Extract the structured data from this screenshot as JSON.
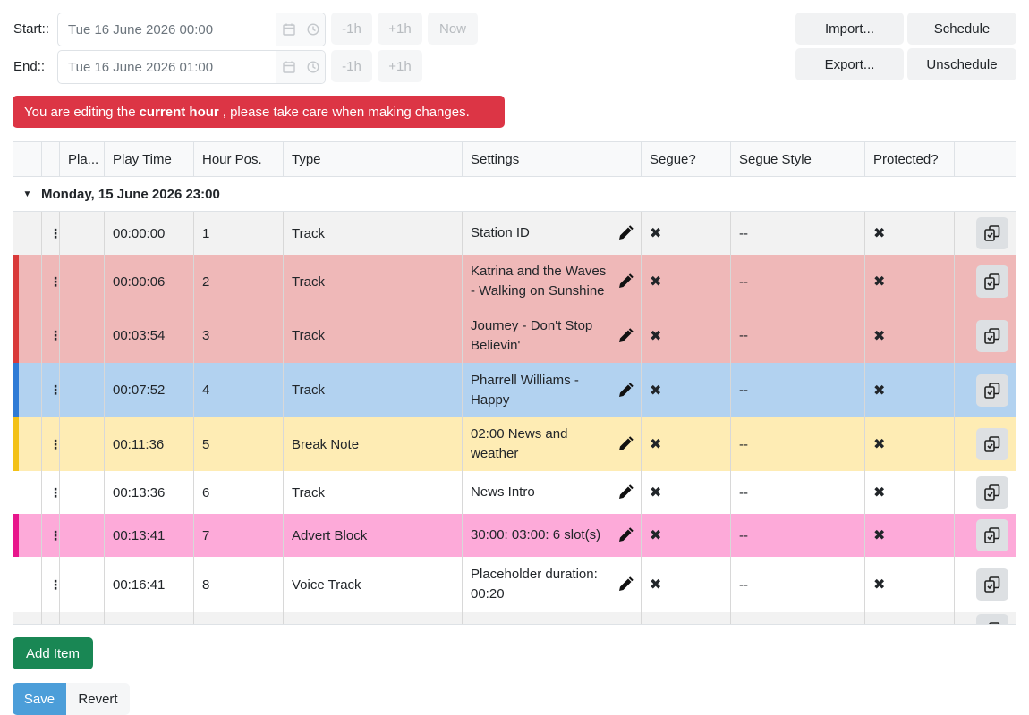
{
  "range": {
    "start_label": "Start::",
    "start_value": "Tue 16 June 2026 00:00",
    "end_label": "End::",
    "end_value": "Tue 16 June 2026 01:00",
    "minus_label": "-1h",
    "plus_label": "+1h",
    "now_label": "Now"
  },
  "actions": {
    "import": "Import...",
    "schedule": "Schedule",
    "export": "Export...",
    "unschedule": "Unschedule"
  },
  "alert": {
    "before": "You are editing the",
    "strong": "current hour",
    "after": ", please take care when making changes."
  },
  "columns": [
    "",
    "",
    "Pla...",
    "Play Time",
    "Hour Pos.",
    "Type",
    "Settings",
    "Segue?",
    "Segue Style",
    "Protected?",
    ""
  ],
  "group_label": "Monday, 15 June 2026 23:00",
  "rows": [
    {
      "time": "00:00:00",
      "pos": "1",
      "type": "Track",
      "settings": "Station ID",
      "segue_style": "--",
      "bg": "#f2f2f2",
      "stripe": ""
    },
    {
      "time": "00:00:06",
      "pos": "2",
      "type": "Track",
      "settings": "Katrina and the Waves - Walking on Sunshine",
      "segue_style": "--",
      "bg": "#efb8b8",
      "stripe": "#d93a3a"
    },
    {
      "time": "00:03:54",
      "pos": "3",
      "type": "Track",
      "settings": "Journey - Don't Stop Believin'",
      "segue_style": "--",
      "bg": "#efb8b8",
      "stripe": "#d93a3a"
    },
    {
      "time": "00:07:52",
      "pos": "4",
      "type": "Track",
      "settings": "Pharrell Williams - Happy",
      "segue_style": "--",
      "bg": "#b2d2f0",
      "stripe": "#2f7bd6"
    },
    {
      "time": "00:11:36",
      "pos": "5",
      "type": "Break Note",
      "settings": "02:00 News and weather",
      "segue_style": "--",
      "bg": "#feecb4",
      "stripe": "#f3c117"
    },
    {
      "time": "00:13:36",
      "pos": "6",
      "type": "Track",
      "settings": "News Intro",
      "segue_style": "--",
      "bg": "#ffffff",
      "stripe": ""
    },
    {
      "time": "00:13:41",
      "pos": "7",
      "type": "Advert Block",
      "settings": "30:00: 03:00: 6 slot(s)",
      "segue_style": "--",
      "bg": "#fdaad9",
      "stripe": "#e8168c"
    },
    {
      "time": "00:16:41",
      "pos": "8",
      "type": "Voice Track",
      "settings": "Placeholder duration: 00:20",
      "segue_style": "--",
      "bg": "#ffffff",
      "stripe": ""
    },
    {
      "time": "",
      "pos": "",
      "type": "",
      "settings": "",
      "segue_style": "",
      "bg": "#f2f2f2",
      "stripe": ""
    }
  ],
  "buttons": {
    "add_item": "Add Item",
    "save": "Save",
    "revert": "Revert"
  },
  "icons": {
    "calendar": "calendar-icon",
    "clock": "clock-icon",
    "drag": "drag-handle-icon",
    "edit": "pencil-icon",
    "no": "x-mark-icon",
    "copy": "copy-icon",
    "caret": "caret-down-icon"
  }
}
